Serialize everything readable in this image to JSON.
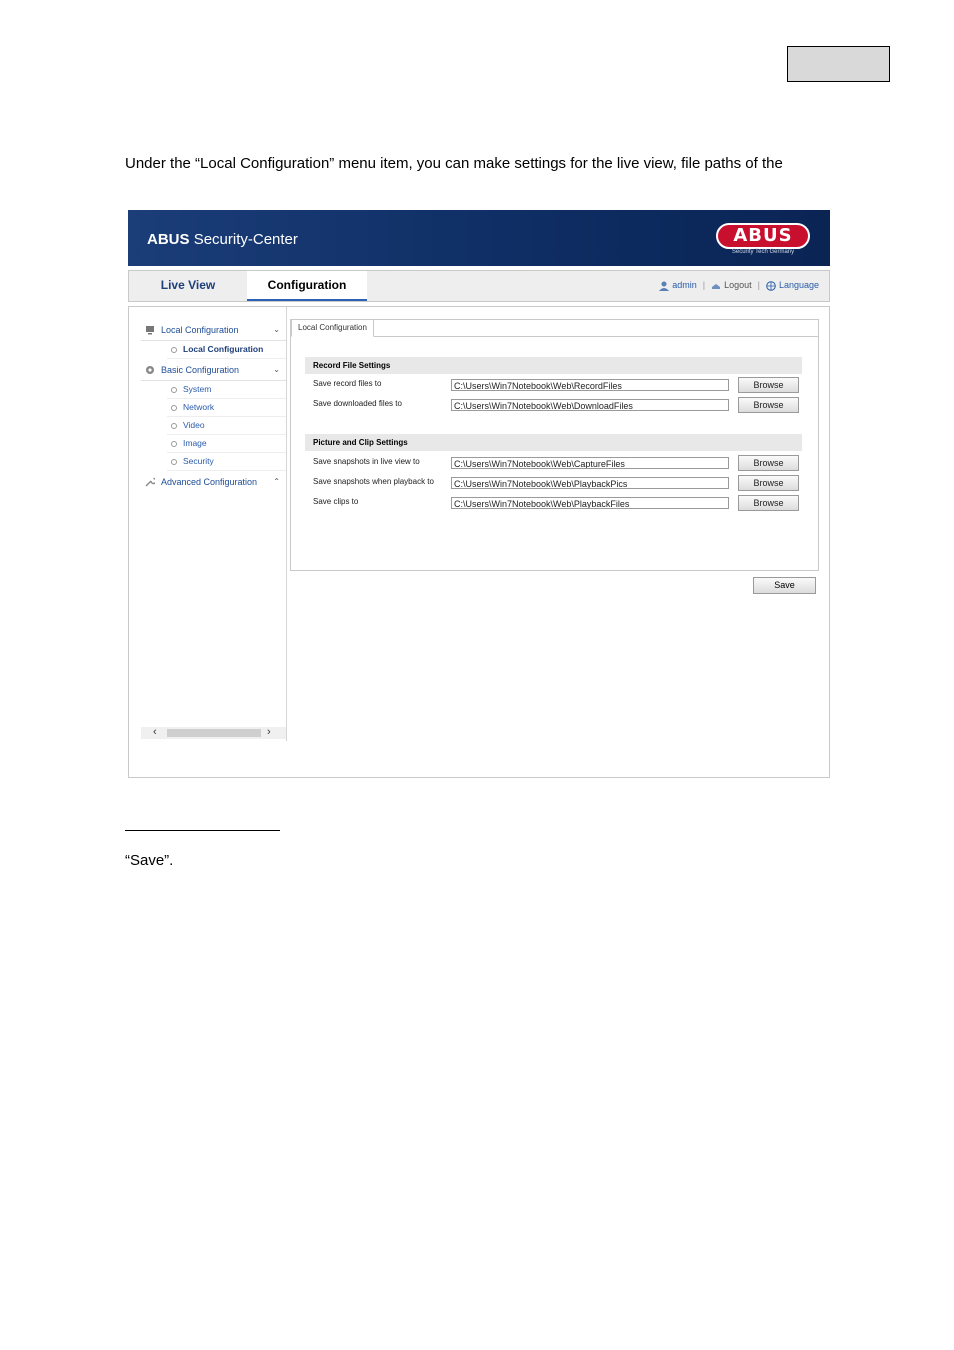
{
  "intro_text": "Under the “Local Configuration” menu item, you can make settings for the live view, file paths of the",
  "banner": {
    "brand": "ABUS",
    "product": "Security-Center",
    "logo_text": "ABUS",
    "logo_sub": "Security Tech Germany"
  },
  "nav": {
    "tabs": [
      "Live View",
      "Configuration"
    ],
    "user": "admin",
    "sep": "|",
    "logout": "Logout",
    "language": "Language"
  },
  "sidebar": {
    "local_config": "Local Configuration",
    "local_config_item": "Local Configuration",
    "basic_config": "Basic Configuration",
    "basic_items": [
      "System",
      "Network",
      "Video",
      "Image",
      "Security"
    ],
    "advanced_config": "Advanced Configuration",
    "chev_down": "⌄",
    "chev_up": "⌃",
    "scroll_left": "‹",
    "scroll_right": "›"
  },
  "content": {
    "tab": "Local Configuration",
    "record_heading": "Record File Settings",
    "record_rows": [
      {
        "label": "Save record files to",
        "path": "C:\\Users\\Win7Notebook\\Web\\RecordFiles",
        "button": "Browse"
      },
      {
        "label": "Save downloaded files to",
        "path": "C:\\Users\\Win7Notebook\\Web\\DownloadFiles",
        "button": "Browse"
      }
    ],
    "picture_heading": "Picture and Clip Settings",
    "picture_rows": [
      {
        "label": "Save snapshots in live view to",
        "path": "C:\\Users\\Win7Notebook\\Web\\CaptureFiles",
        "button": "Browse"
      },
      {
        "label": "Save snapshots when playback to",
        "path": "C:\\Users\\Win7Notebook\\Web\\PlaybackPics",
        "button": "Browse"
      },
      {
        "label": "Save clips to",
        "path": "C:\\Users\\Win7Notebook\\Web\\PlaybackFiles",
        "button": "Browse"
      }
    ],
    "save_button": "Save"
  },
  "footer_text": "“Save”.",
  "colors": {
    "banner": "#0f2f66",
    "logo": "#c8102e",
    "link": "#2a5caa"
  }
}
